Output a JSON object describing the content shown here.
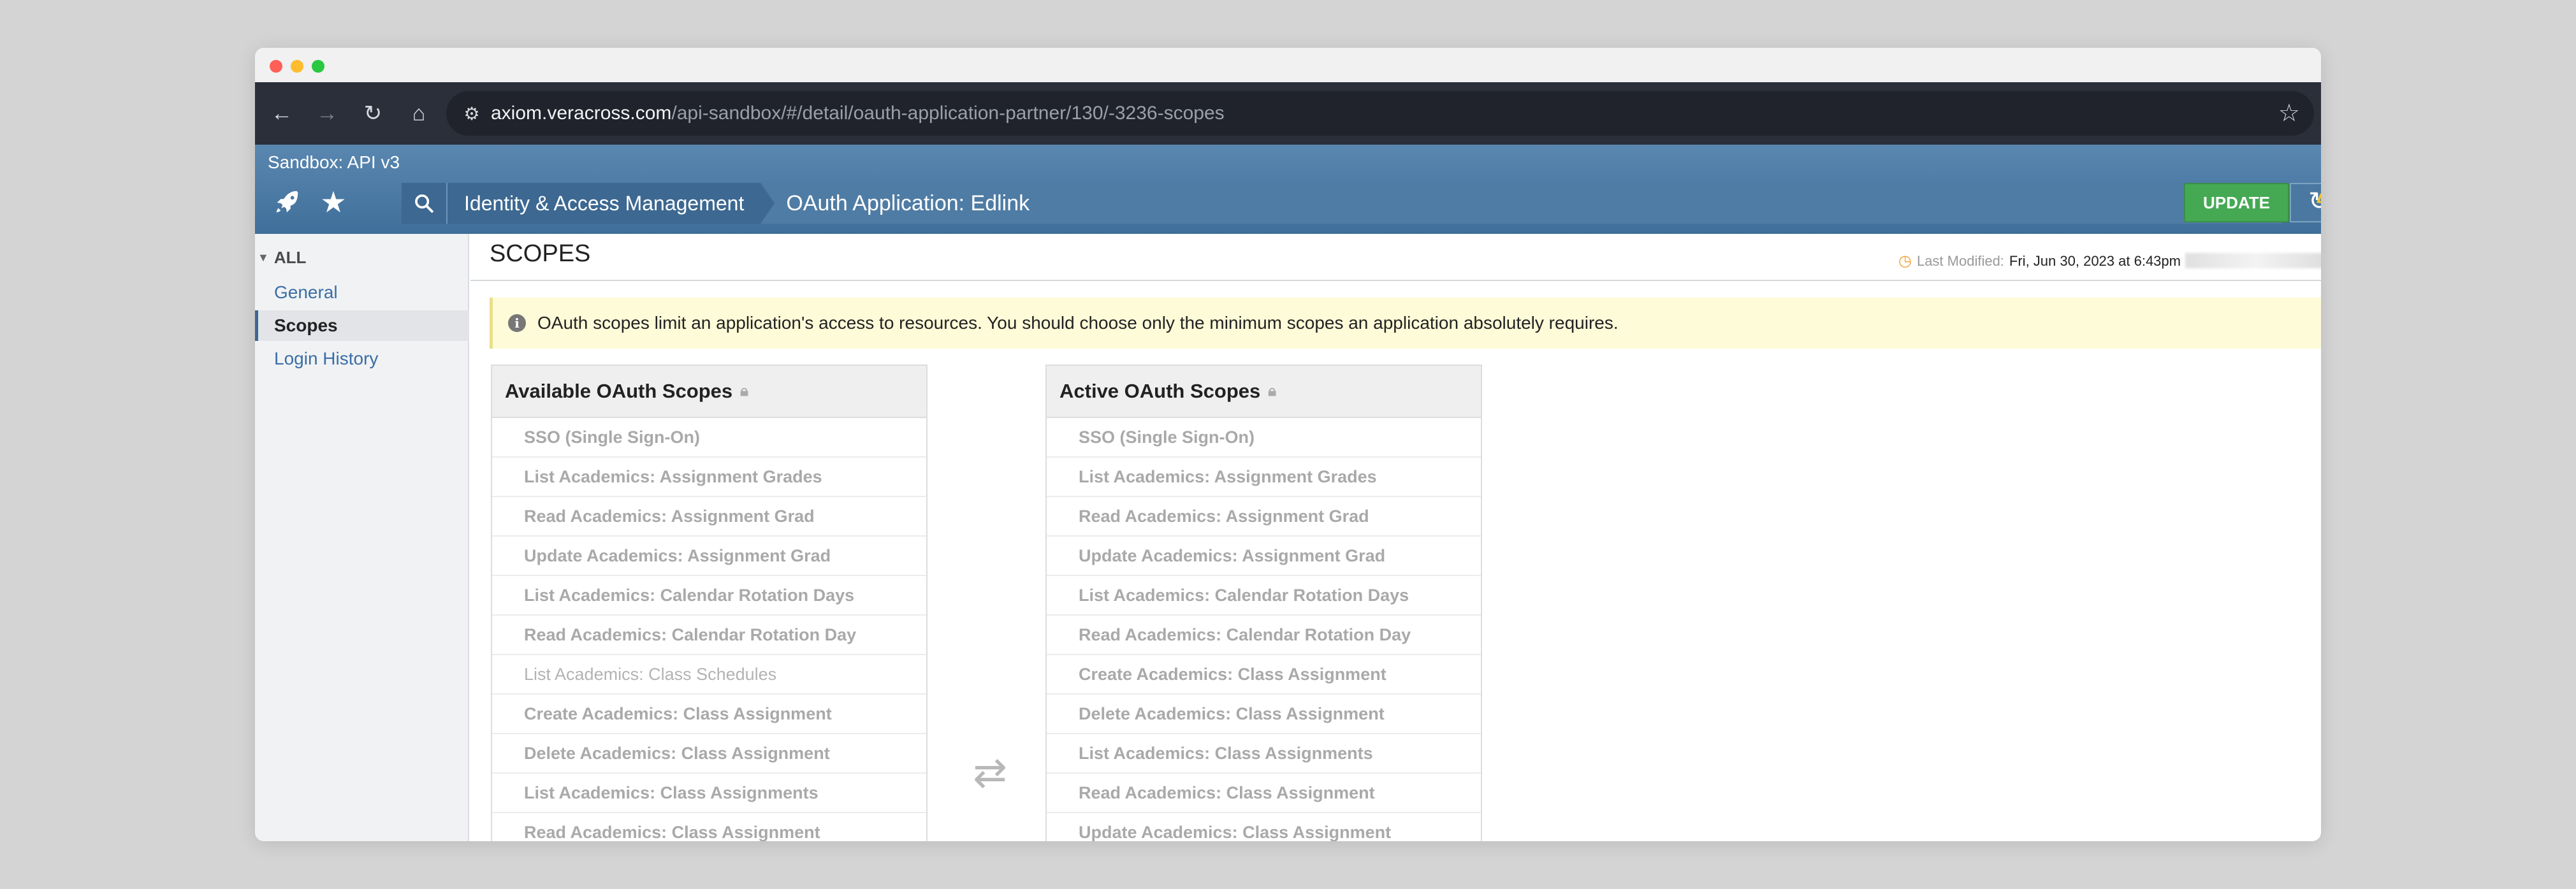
{
  "browser": {
    "url_host": "axiom.veracross.com",
    "url_path": "/api-sandbox/#/detail/oauth-application-partner/130/-3236-scopes",
    "icons": [
      "back-icon",
      "forward-icon",
      "reload-icon",
      "home-icon",
      "site-settings-icon",
      "bookmark-star-icon"
    ]
  },
  "header": {
    "sandbox_label": "Sandbox: API v3",
    "breadcrumb_root": "Identity & Access Management",
    "breadcrumb_current": "OAuth Application: Edlink",
    "update_label": "UPDATE",
    "colors": {
      "header": "#4a79a3",
      "update": "#45a954",
      "lightning": "#f4c430"
    }
  },
  "sidebar": {
    "all_label": "ALL",
    "items": [
      {
        "label": "General",
        "active": false
      },
      {
        "label": "Scopes",
        "active": true
      },
      {
        "label": "Login History",
        "active": false
      }
    ]
  },
  "main": {
    "title": "SCOPES",
    "last_modified_label": "Last Modified:",
    "last_modified_value": "Fri, Jun 30, 2023 at 6:43pm",
    "info_message": "OAuth scopes limit an application's access to resources. You should choose only the minimum scopes an application absolutely requires."
  },
  "available_panel": {
    "title": "Available OAuth Scopes",
    "items": [
      "SSO (Single Sign-On)",
      "List Academics: Assignment Grades",
      "Read Academics: Assignment Grad",
      "Update Academics: Assignment Grad",
      "List Academics: Calendar Rotation Days",
      "Read Academics: Calendar Rotation Day",
      "List Academics: Class Schedules",
      "Create Academics: Class Assignment",
      "Delete Academics: Class Assignment",
      "List Academics: Class Assignments",
      "Read Academics: Class Assignment"
    ]
  },
  "active_panel": {
    "title": "Active OAuth Scopes",
    "items": [
      "SSO (Single Sign-On)",
      "List Academics: Assignment Grades",
      "Read Academics: Assignment Grad",
      "Update Academics: Assignment Grad",
      "List Academics: Calendar Rotation Days",
      "Read Academics: Calendar Rotation Day",
      "Create Academics: Class Assignment",
      "Delete Academics: Class Assignment",
      "List Academics: Class Assignments",
      "Read Academics: Class Assignment",
      "Update Academics: Class Assignment"
    ]
  }
}
